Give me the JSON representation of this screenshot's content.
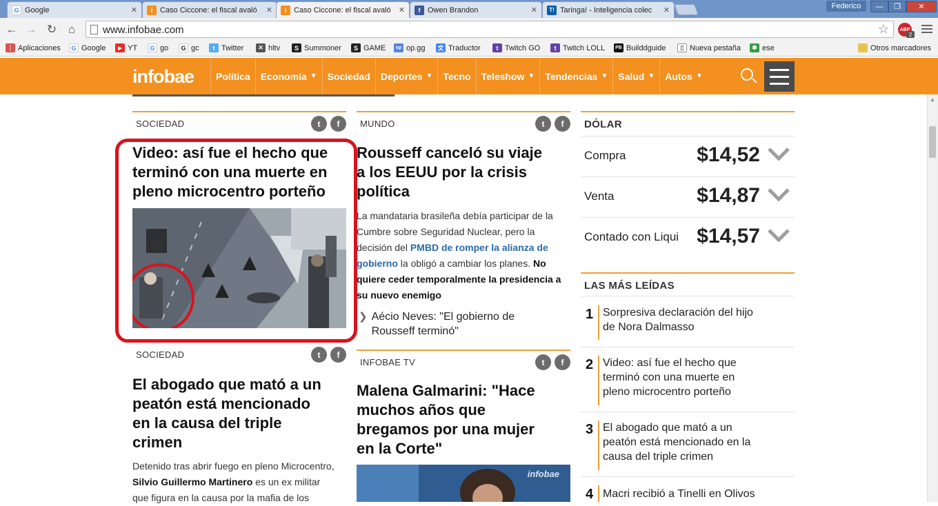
{
  "browser": {
    "tabs": [
      {
        "label": "Google",
        "color": "#ffffff",
        "glyph": "G",
        "glyph_color": "#4285f4"
      },
      {
        "label": "Caso Ciccone: el fiscal avaló",
        "color": "#f3901f",
        "glyph": "i",
        "glyph_color": "#ffffff"
      },
      {
        "label": "Caso Ciccone: el fiscal avaló",
        "color": "#f3901f",
        "glyph": "i",
        "glyph_color": "#ffffff"
      },
      {
        "label": "Owen Brandon",
        "color": "#3b5998",
        "glyph": "f",
        "glyph_color": "#ffffff"
      },
      {
        "label": "Taringa! - Inteligencia colec",
        "color": "#0c5fa8",
        "glyph": "T!",
        "glyph_color": "#ffffff"
      }
    ],
    "user": "Federico",
    "url": "www.infobae.com",
    "abp_count": "2",
    "bookmarks": [
      {
        "label": "Aplicaciones",
        "color": "#d9534f",
        "glyph": "⋮"
      },
      {
        "label": "Google",
        "color": "#ffffff",
        "glyph": "G"
      },
      {
        "label": "YT",
        "color": "#e52d27",
        "glyph": "▶"
      },
      {
        "label": "go",
        "color": "#ffffff",
        "glyph": "G"
      },
      {
        "label": "gc",
        "color": "#ffffff",
        "glyph": "G"
      },
      {
        "label": "Twitter",
        "color": "#55acee",
        "glyph": "t"
      },
      {
        "label": "hltv",
        "color": "#555555",
        "glyph": "✕"
      },
      {
        "label": "Summoner",
        "color": "#222222",
        "glyph": "S"
      },
      {
        "label": "GAME",
        "color": "#222222",
        "glyph": "S"
      },
      {
        "label": "op.gg",
        "color": "#5383e8",
        "glyph": "op"
      },
      {
        "label": "Traductor",
        "color": "#4285f4",
        "glyph": "文"
      },
      {
        "label": "Twitch GO",
        "color": "#6441a5",
        "glyph": "t"
      },
      {
        "label": "Twitch LOLL",
        "color": "#6441a5",
        "glyph": "t"
      },
      {
        "label": "Builddguide",
        "color": "#111111",
        "glyph": "PB"
      },
      {
        "label": "Nueva pestaña",
        "color": "#ffffff",
        "glyph": "▯"
      },
      {
        "label": "ese",
        "color": "#2e9e3f",
        "glyph": "✱"
      }
    ],
    "other_bookmarks": "Otros marcadores"
  },
  "site": {
    "logo": "infobae",
    "nav": [
      {
        "label": "Política",
        "caret": false
      },
      {
        "label": "Economía",
        "caret": true
      },
      {
        "label": "Sociedad",
        "caret": false
      },
      {
        "label": "Deportes",
        "caret": true
      },
      {
        "label": "Tecno",
        "caret": false
      },
      {
        "label": "Teleshow",
        "caret": true
      },
      {
        "label": "Tendencias",
        "caret": true
      },
      {
        "label": "Salud",
        "caret": true
      },
      {
        "label": "Autos",
        "caret": true
      }
    ]
  },
  "left": {
    "story1": {
      "section": "SOCIEDAD",
      "headline_lines": [
        "Video: así fue el hecho que",
        "terminó con una muerte en",
        "pleno microcentro porteño"
      ]
    },
    "story2": {
      "section": "SOCIEDAD",
      "headline_lines": [
        "El abogado que mató a un",
        "peatón está mencionado",
        "en la causa del triple",
        "crimen"
      ],
      "body_lines": [
        "Detenido tras abrir fuego en pleno Microcentro,",
        "Silvio Guillermo Martinero",
        " es un ex militar",
        "que figura en la causa por la mafia de los"
      ]
    }
  },
  "middle": {
    "story1": {
      "section": "MUNDO",
      "headline_lines": [
        "Rousseff canceló su viaje",
        "a los EEUU por la crisis",
        "política"
      ],
      "body": {
        "l1": "La mandataria brasileña debía participar de la",
        "l2": "Cumbre sobre Seguridad Nuclear, pero la",
        "l3a": "decisión del ",
        "l3b": "PMBD de romper la alianza de",
        "l4a": "gobierno",
        "l4b": " la obligó a cambiar los planes. ",
        "l4c": "No",
        "l5": "quiere ceder temporalmente la presidencia a",
        "l6": "su nuevo enemigo"
      },
      "related": [
        "Aécio Neves: \"El gobierno de",
        "Rousseff terminó\""
      ]
    },
    "story2": {
      "section": "INFOBAE TV",
      "headline_lines": [
        "Malena Galmarini: \"Hace",
        "muchos años que",
        "bregamos por una mujer",
        "en la Corte\""
      ],
      "tv_logo": "infobae"
    }
  },
  "right": {
    "dolar": {
      "title": "DÓLAR",
      "rows": [
        {
          "label": "Compra",
          "value": "$14,52"
        },
        {
          "label": "Venta",
          "value": "$14,87"
        },
        {
          "label": "Contado con Liqui",
          "value": "$14,57"
        }
      ]
    },
    "most_read": {
      "title": "LAS MÁS LEÍDAS",
      "items": [
        {
          "num": "1",
          "lines": [
            "Sorpresiva declaración del hijo",
            "de Nora Dalmasso"
          ]
        },
        {
          "num": "2",
          "lines": [
            "Video: así fue el hecho que",
            "terminó con una muerte en",
            "pleno microcentro porteño"
          ]
        },
        {
          "num": "3",
          "lines": [
            "El abogado que mató a un",
            "peatón está mencionado en la",
            "causa del triple crimen"
          ]
        },
        {
          "num": "4",
          "lines": [
            "Macri recibió a Tinelli en Olivos"
          ]
        }
      ]
    }
  },
  "colors": {
    "brand": "#f3901f",
    "highlight_frame": "#d7141e",
    "link": "#2b6aa8"
  }
}
